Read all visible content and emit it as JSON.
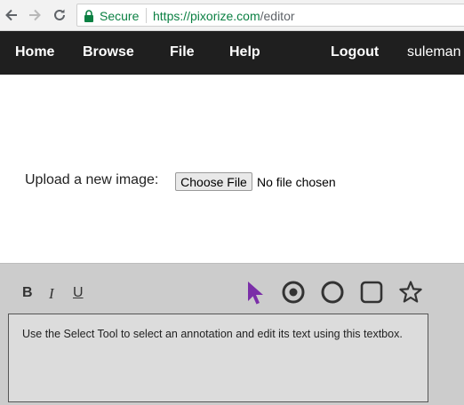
{
  "browser": {
    "secure_label": "Secure",
    "url_scheme_host": "https://pixorize.com",
    "url_path": "/editor",
    "icons": [
      "back-icon",
      "forward-icon",
      "reload-icon",
      "lock-icon"
    ]
  },
  "nav": {
    "home": "Home",
    "browse": "Browse",
    "file": "File",
    "help": "Help",
    "logout": "Logout",
    "username": "suleman"
  },
  "upload": {
    "label": "Upload a new image:",
    "button": "Choose File",
    "status": "No file chosen"
  },
  "panel": {
    "bold": "B",
    "italic": "I",
    "underline": "U",
    "tools": [
      "select-tool-icon",
      "target-tool-icon",
      "circle-tool-icon",
      "square-tool-icon",
      "star-tool-icon"
    ],
    "textbox_text": "Use the Select Tool to select an annotation and edit its text using this textbox."
  },
  "colors": {
    "secure_green": "#0b8043",
    "nav_bg": "#1f1f1f",
    "panel_bg": "#cccccc",
    "select_tool_accent": "#7b2fa8"
  }
}
